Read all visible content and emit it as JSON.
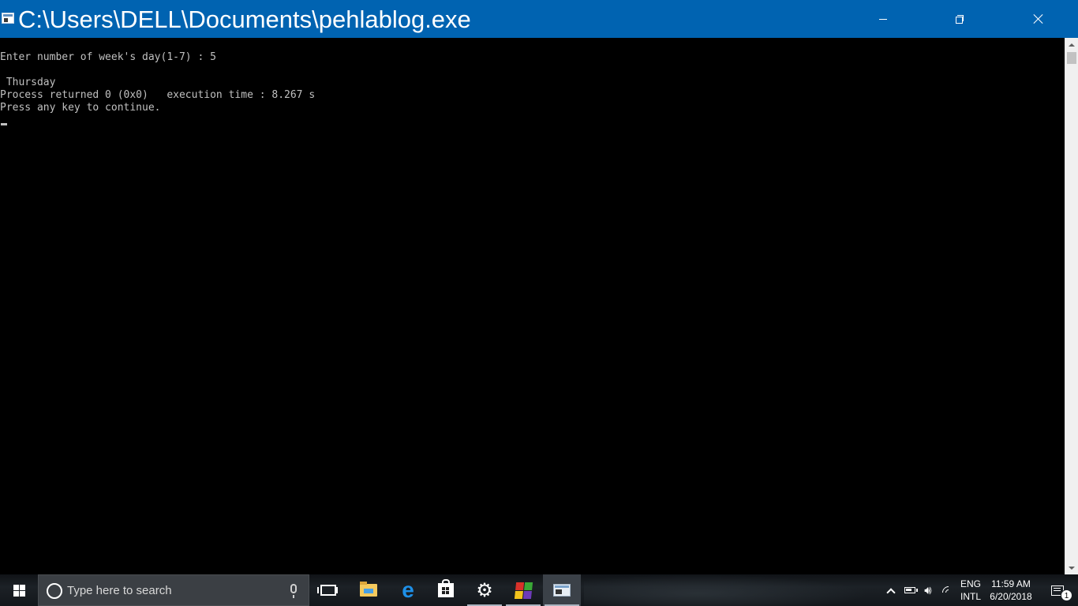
{
  "window": {
    "title": "C:\\Users\\DELL\\Documents\\pehlablog.exe"
  },
  "console": {
    "lines": [
      "Enter number of week's day(1-7) : 5",
      "",
      " Thursday",
      "Process returned 0 (0x0)   execution time : 8.267 s",
      "Press any key to continue."
    ]
  },
  "taskbar": {
    "search_placeholder": "Type here to search",
    "apps": [
      {
        "name": "Task View",
        "icon": "task-view-icon"
      },
      {
        "name": "File Explorer",
        "icon": "folder-icon"
      },
      {
        "name": "Microsoft Edge",
        "icon": "edge-icon"
      },
      {
        "name": "Microsoft Store",
        "icon": "store-icon"
      },
      {
        "name": "Settings",
        "icon": "gear-icon"
      },
      {
        "name": "Code::Blocks",
        "icon": "codeblocks-icon"
      },
      {
        "name": "Console",
        "icon": "console-app-icon"
      }
    ],
    "tray": {
      "language_top": "ENG",
      "language_bottom": "INTL",
      "time": "11:59 AM",
      "date": "6/20/2018",
      "notification_count": "1"
    }
  },
  "colors": {
    "titlebar": "#0063b1",
    "console_bg": "#000000",
    "console_text": "#c0c0c0"
  }
}
